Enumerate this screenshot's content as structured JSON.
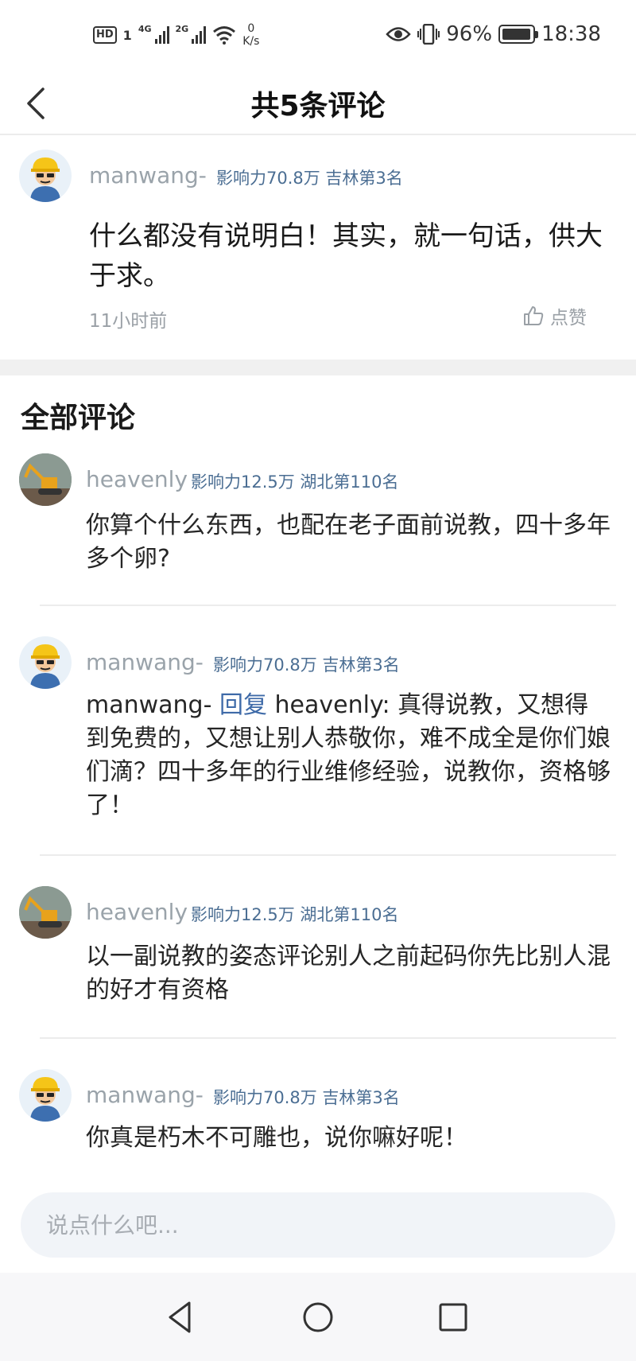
{
  "status_bar": {
    "hd": "HD",
    "sim": "1",
    "net1": "4G",
    "net2": "2G",
    "speed_value": "0",
    "speed_unit": "K/s",
    "battery_percent": "96%",
    "battery_level": 0.96,
    "time": "18:38"
  },
  "header": {
    "title": "共5条评论"
  },
  "original": {
    "username": "manwang-",
    "meta": "影响力70.8万 吉林第3名",
    "text": " 什么都没有说明白！其实，就一句话，供大于求。",
    "time": "11小时前",
    "like_label": "点赞"
  },
  "section_title": "全部评论",
  "comments": [
    {
      "username": "heavenly",
      "meta": "影响力12.5万 湖北第110名",
      "text": " 你算个什么东西，也配在老子面前说教，四十多年多个卵?"
    },
    {
      "username": "manwang-",
      "meta": "影响力70.8万 吉林第3名",
      "reply_from": "manwang-",
      "reply_label": "回复",
      "reply_to": "heavenly:",
      "text": " 真得说教，又想得到免费的，又想让别人恭敬你，难不成全是你们娘们滴？四十多年的行业维修经验，说教你，资格够了！"
    },
    {
      "username": "heavenly",
      "meta": "影响力12.5万 湖北第110名",
      "text": " 以一副说教的姿态评论别人之前起码你先比别人混的好才有资格"
    },
    {
      "username": "manwang-",
      "meta": "影响力70.8万 吉林第3名",
      "text": " 你真是朽木不可雕也，说你嘛好呢！"
    }
  ],
  "input": {
    "placeholder": "说点什么吧..."
  },
  "icons": [
    "back-arrow-icon",
    "thumb-up-icon",
    "eye-icon",
    "vibrate-icon",
    "wifi-icon",
    "nav-back-icon",
    "nav-home-icon",
    "nav-recent-icon"
  ]
}
